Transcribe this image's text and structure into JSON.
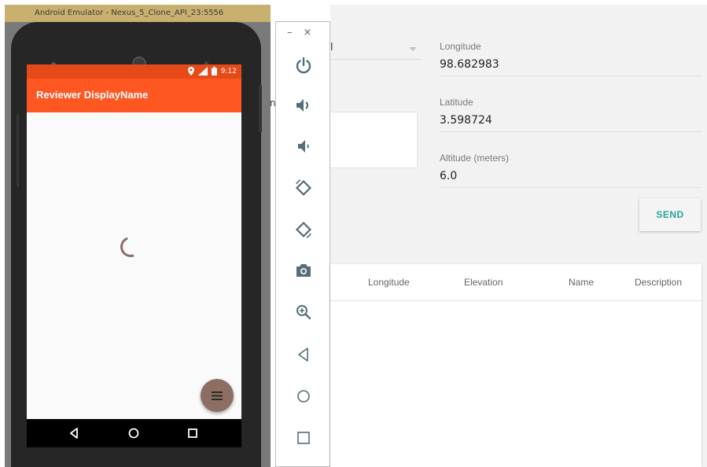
{
  "emulator": {
    "window_title": "Android Emulator - Nexus_5_Clone_API_23:5556",
    "status_time": "9:12",
    "app_title": "Reviewer DisplayName"
  },
  "toolbar": {
    "minimize_label": "–",
    "close_label": "×",
    "items": [
      "power-icon",
      "volume-up-icon",
      "volume-down-icon",
      "rotate-left-icon",
      "rotate-right-icon",
      "camera-icon",
      "zoom-icon",
      "back-icon",
      "home-icon",
      "overview-icon"
    ]
  },
  "form": {
    "select_value": "l",
    "stray_char": "n",
    "longitude": {
      "label": "Longitude",
      "value": "98.682983"
    },
    "latitude": {
      "label": "Latitude",
      "value": "3.598724"
    },
    "altitude": {
      "label": "Altitude (meters)",
      "value": "6.0"
    },
    "send_label": "SEND"
  },
  "table": {
    "headers": [
      "Longitude",
      "Elevation",
      "Name",
      "Description"
    ]
  },
  "colors": {
    "appbar": "#ff5722",
    "statusbar": "#e64a19",
    "fab": "#8d6e63",
    "accent": "#26a69a"
  }
}
